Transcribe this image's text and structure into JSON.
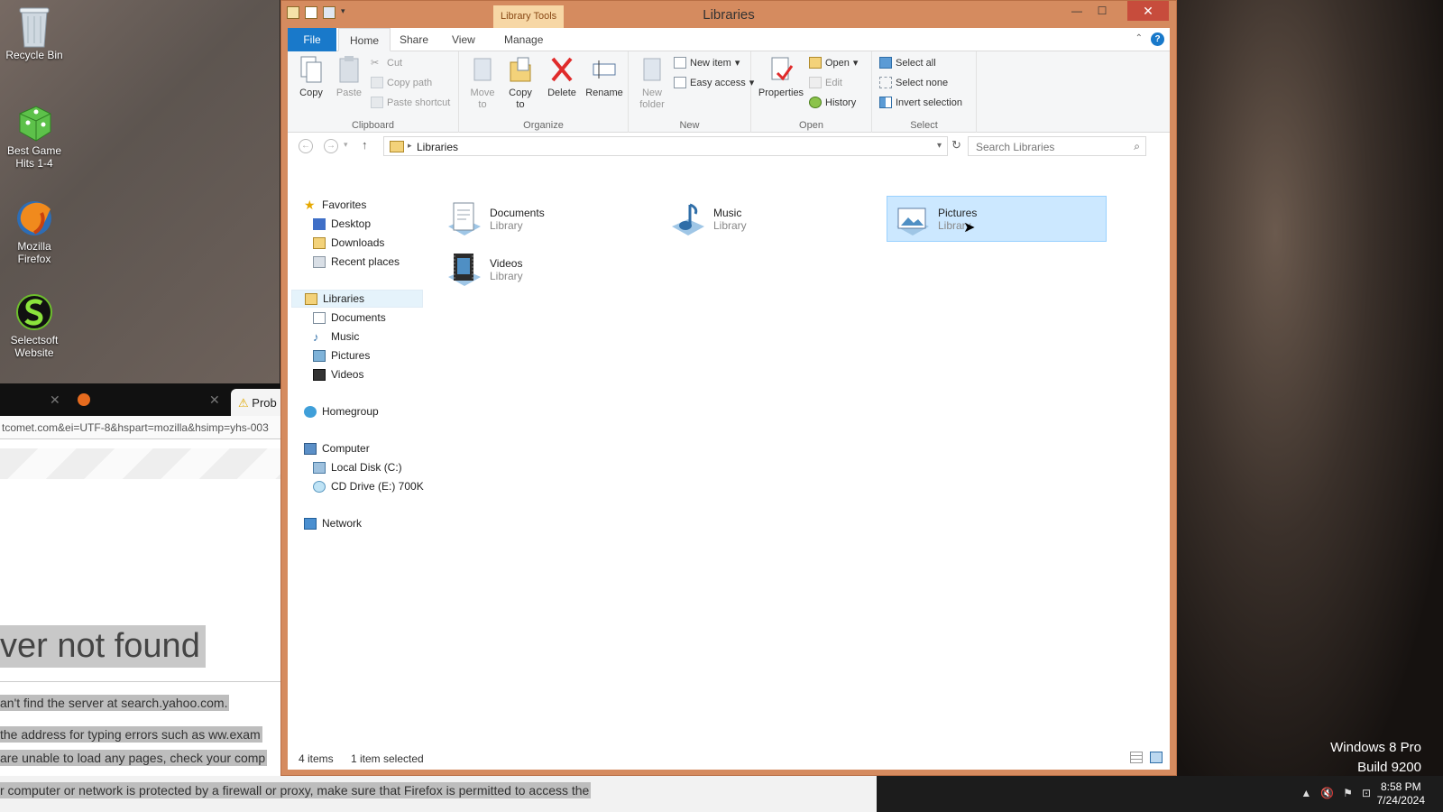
{
  "desktop": {
    "icons": [
      {
        "label": "Recycle Bin"
      },
      {
        "label": "Best Game Hits 1-4"
      },
      {
        "label": "Mozilla Firefox"
      },
      {
        "label": "Selectsoft Website"
      }
    ],
    "brand_line1": "Windows 8 Pro",
    "brand_line2": "Build 9200"
  },
  "firefox": {
    "tab_label": "Prob",
    "url": "tcomet.com&ei=UTF-8&hspart=mozilla&hsimp=yhs-003",
    "heading": "ver not found",
    "line1": "an't find the server at search.yahoo.com.",
    "line2": "the address for typing errors such as ww.exam",
    "line2_bold": "ww",
    "line3": "are unable to load any pages, check your comp",
    "line4": "r computer or network is protected by a firewall or proxy, make sure that Firefox is permitted to access the"
  },
  "taskbar": {
    "time": "8:58 PM",
    "date": "7/24/2024"
  },
  "explorer": {
    "title": "Libraries",
    "context_tab": "Library Tools",
    "tabs": {
      "file": "File",
      "home": "Home",
      "share": "Share",
      "view": "View",
      "manage": "Manage"
    },
    "ribbon": {
      "clipboard": {
        "label": "Clipboard",
        "copy": "Copy",
        "paste": "Paste",
        "cut": "Cut",
        "copy_path": "Copy path",
        "paste_shortcut": "Paste shortcut"
      },
      "organize": {
        "label": "Organize",
        "move_to": "Move to",
        "copy_to": "Copy to",
        "delete": "Delete",
        "rename": "Rename"
      },
      "new": {
        "label": "New",
        "new_folder": "New folder",
        "new_item": "New item",
        "easy_access": "Easy access"
      },
      "open": {
        "label": "Open",
        "properties": "Properties",
        "open": "Open",
        "edit": "Edit",
        "history": "History"
      },
      "select": {
        "label": "Select",
        "select_all": "Select all",
        "select_none": "Select none",
        "invert": "Invert selection"
      }
    },
    "address": "Libraries",
    "search_placeholder": "Search Libraries",
    "nav": {
      "favorites": "Favorites",
      "desktop": "Desktop",
      "downloads": "Downloads",
      "recent": "Recent places",
      "libraries": "Libraries",
      "documents": "Documents",
      "music": "Music",
      "pictures": "Pictures",
      "videos": "Videos",
      "homegroup": "Homegroup",
      "computer": "Computer",
      "local_disk": "Local Disk (C:)",
      "cd_drive": "CD Drive (E:) 700K",
      "network": "Network"
    },
    "items": [
      {
        "name": "Documents",
        "type": "Library"
      },
      {
        "name": "Music",
        "type": "Library"
      },
      {
        "name": "Pictures",
        "type": "Library"
      },
      {
        "name": "Videos",
        "type": "Library"
      }
    ],
    "status": {
      "count": "4 items",
      "selected": "1 item selected"
    }
  }
}
